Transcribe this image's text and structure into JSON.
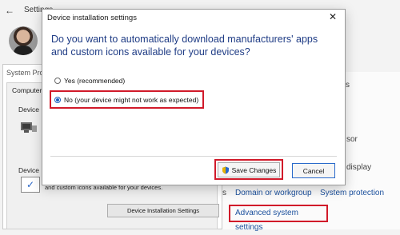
{
  "settings": {
    "title": "Settings",
    "right_fragments": {
      "s_fragment": "s",
      "sor_fragment": "sor",
      "display_fragment": "display",
      "s_left_fragment": "s"
    },
    "links": {
      "domain": "Domain or workgroup",
      "protection": "System protection",
      "advanced": "Advanced system settings"
    }
  },
  "system_properties": {
    "title": "System Prop",
    "computer_name_label": "Computer Na",
    "device_manager_label": "Device Ma",
    "device_install_label": "Device Ins",
    "body_text": "and custom icons available for your devices.",
    "button_label": "Device Installation Settings"
  },
  "dialog": {
    "title": "Device installation settings",
    "question": "Do you want to automatically download manufacturers' apps and custom icons available for your devices?",
    "options": [
      {
        "label": "Yes (recommended)",
        "checked": false
      },
      {
        "label": "No (your device might not work as expected)",
        "checked": true
      }
    ],
    "save_label": "Save Changes",
    "cancel_label": "Cancel",
    "close_symbol": "✕"
  },
  "colors": {
    "highlight": "#d11a2a",
    "link": "#1a4f9c",
    "question": "#1f3c85"
  }
}
